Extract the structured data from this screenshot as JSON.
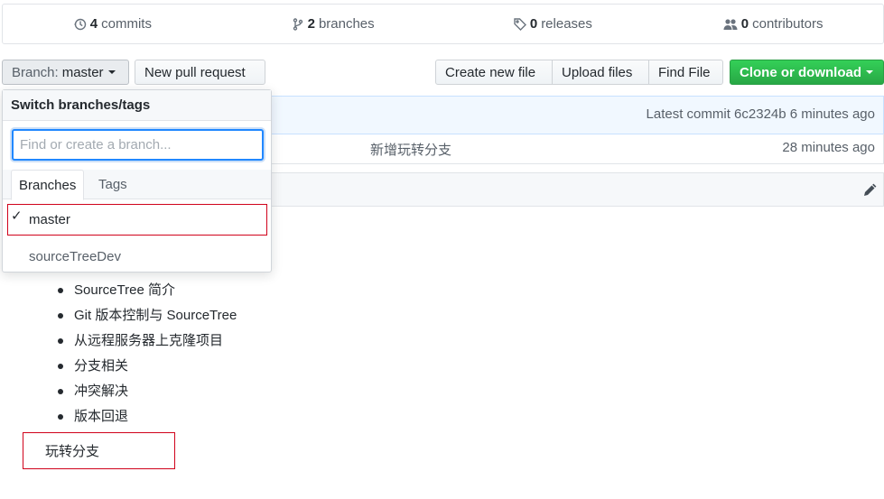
{
  "summary": {
    "commits": {
      "count": "4",
      "label": "commits",
      "icon": "history-icon"
    },
    "branches": {
      "count": "2",
      "label": "branches",
      "icon": "git-branch-icon"
    },
    "releases": {
      "count": "0",
      "label": "releases",
      "icon": "tag-icon"
    },
    "contributors": {
      "count": "0",
      "label": "contributors",
      "icon": "people-icon"
    }
  },
  "toolbar": {
    "branch_prefix": "Branch:",
    "branch_name": "master",
    "new_pull_request": "New pull request",
    "create_new_file": "Create new file",
    "upload_files": "Upload files",
    "find_file": "Find File",
    "clone_or_download": "Clone or download"
  },
  "commit_tease": {
    "latest_commit": "Latest commit 6c2324b 6 minutes ago"
  },
  "file_row": {
    "message": "新增玩转分支",
    "age": "28 minutes ago"
  },
  "readme": {
    "items": [
      "SourceTree 简介",
      "Git 版本控制与 SourceTree",
      "从远程服务器上克隆项目",
      "分支相关",
      "冲突解决",
      "版本回退"
    ],
    "branch_note": "玩转分支"
  },
  "dropdown": {
    "header": "Switch branches/tags",
    "filter_placeholder": "Find or create a branch...",
    "tabs": [
      "Branches",
      "Tags"
    ],
    "branches": [
      {
        "name": "master",
        "selected": true
      },
      {
        "name": "sourceTreeDev",
        "selected": false
      }
    ],
    "check_mark": "✓"
  },
  "colors": {
    "accent_blue": "#2188ff",
    "green_button": "#28a745",
    "highlight_red": "#d0021b"
  }
}
